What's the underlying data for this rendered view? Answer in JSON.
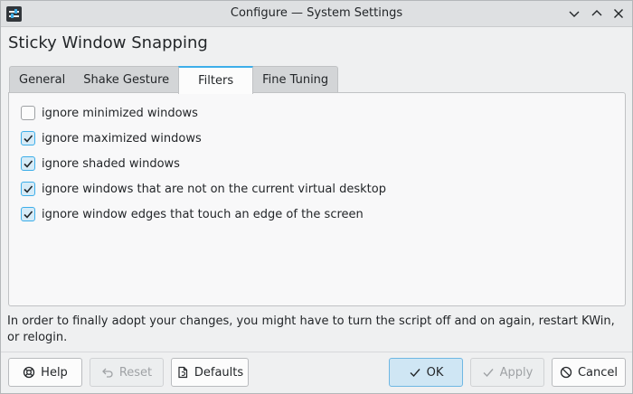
{
  "window": {
    "title": "Configure — System Settings"
  },
  "page": {
    "title": "Sticky Window Snapping"
  },
  "tabs": [
    {
      "label": "General"
    },
    {
      "label": "Shake Gesture"
    },
    {
      "label": "Filters",
      "active": true
    },
    {
      "label": "Fine Tuning"
    }
  ],
  "filters": [
    {
      "label": "ignore minimized windows",
      "checked": false
    },
    {
      "label": "ignore maximized windows",
      "checked": true
    },
    {
      "label": "ignore shaded windows",
      "checked": true
    },
    {
      "label": "ignore windows that are not on the current virtual desktop",
      "checked": true
    },
    {
      "label": "ignore window edges that touch an edge of the screen",
      "checked": true
    }
  ],
  "info_text": "In order to finally adopt your changes, you might have to turn the script off and on again, restart KWin, or relogin.",
  "buttons": {
    "help": "Help",
    "reset": "Reset",
    "defaults": "Defaults",
    "ok": "OK",
    "apply": "Apply",
    "cancel": "Cancel"
  },
  "colors": {
    "accent": "#3daee9",
    "window_bg": "#eff0f1"
  }
}
